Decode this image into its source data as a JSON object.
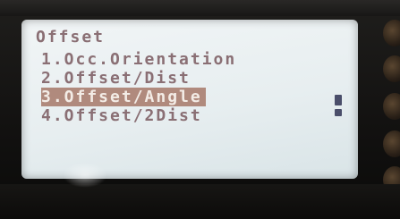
{
  "screen": {
    "title": "Offset",
    "menu_items": [
      "1.Occ.Orientation",
      "2.Offset/Dist",
      "3.Offset/Angle",
      "4.Offset/2Dist"
    ],
    "selected_index": 2
  },
  "colors": {
    "lcd_background": "#eef3f4",
    "text": "#8a6f74",
    "highlight_background": "#b08a7d",
    "highlight_text": "#f3ece6",
    "scroll_indicator": "#4a4e6a"
  }
}
